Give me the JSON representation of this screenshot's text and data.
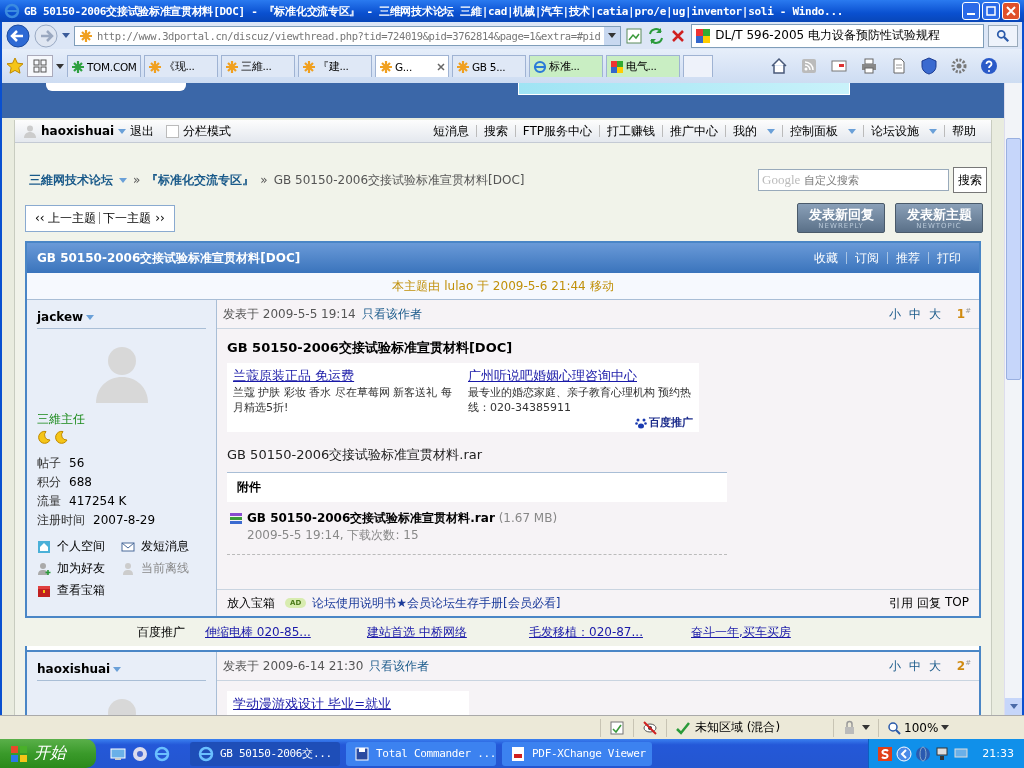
{
  "window": {
    "title": "GB 50150-2006交接试验标准宣贯材料[DOC] - 『标准化交流专区』 - 三维网技术论坛 三維|cad|机械|汽车|技术|catia|pro/e|ug|inventor|soli - Windo..."
  },
  "address_bar": {
    "url": "http://www.3dportal.cn/discuz/viewthread.php?tid=724019&pid=3762814&page=1&extra=#pid",
    "search_value": "DL/T 596-2005 电力设备预防性试验规程"
  },
  "tabs": [
    {
      "label": "TOM.COM",
      "kind": "tom",
      "selected": false
    },
    {
      "label": "《现...",
      "kind": "flower",
      "selected": false
    },
    {
      "label": "三維...",
      "kind": "flower",
      "selected": false
    },
    {
      "label": "『建...",
      "kind": "flower",
      "selected": false
    },
    {
      "label": "G...",
      "kind": "flower",
      "selected": true
    },
    {
      "label": "GB 5...",
      "kind": "flower",
      "selected": false
    },
    {
      "label": "标准...",
      "kind": "ie",
      "selected": false,
      "color": "#c9eec3"
    },
    {
      "label": "电气...",
      "kind": "google",
      "selected": false,
      "color": "#c9eec3"
    }
  ],
  "forum": {
    "user_bar": {
      "username": "haoxishuai",
      "logout": "退出",
      "split_mode": {
        "label": "分栏模式",
        "checked": false
      },
      "menu": [
        {
          "label": "短消息",
          "dropdown": false
        },
        {
          "label": "搜索",
          "dropdown": false
        },
        {
          "label": "FTP服务中心",
          "dropdown": false
        },
        {
          "label": "打工赚钱",
          "dropdown": false
        },
        {
          "label": "推广中心",
          "dropdown": false
        },
        {
          "label": "我的",
          "dropdown": true
        },
        {
          "label": "控制面板",
          "dropdown": true
        },
        {
          "label": "论坛设施",
          "dropdown": true
        },
        {
          "label": "帮助",
          "dropdown": false
        }
      ]
    },
    "breadcrumb": {
      "separator": "»",
      "items": [
        "三維网技术论坛",
        "『标准化交流专区』",
        "GB 50150-2006交接试验标准宣贯材料[DOC]"
      ]
    },
    "search": {
      "logo": "Google",
      "placeholder": "自定义搜索",
      "button": "搜索"
    },
    "thread_nav": [
      "‹‹ 上一主题",
      "下一主题 ››"
    ],
    "action_buttons": [
      {
        "label": "发表新回复",
        "sublabel": "NEWREPLY"
      },
      {
        "label": "发表新主题",
        "sublabel": "NEWTOPIC"
      }
    ],
    "thread": {
      "title": "GB 50150-2006交接试验标准宣贯材料[DOC]",
      "actions": [
        "收藏",
        "订阅",
        "推荐",
        "打印"
      ],
      "notice": "本主题由 lulao 于 2009-5-6 21:44 移动"
    },
    "posts": [
      {
        "author": "jackew",
        "rank": "三維主任",
        "rank_icons": [
          {
            "kind": "moon"
          },
          {
            "kind": "moon"
          }
        ],
        "stats": [
          {
            "label": "帖子",
            "value": "56"
          },
          {
            "label": "积分",
            "value": "688"
          },
          {
            "label": "流量",
            "value": "417254 K"
          },
          {
            "label": "注册时间",
            "value": "2007-8-29"
          }
        ],
        "links": [
          {
            "label": "个人空间",
            "kind": "home"
          },
          {
            "label": "发短消息",
            "kind": "mail"
          },
          {
            "label": "加为好友",
            "kind": "add"
          },
          {
            "label": "当前离线",
            "kind": "offline"
          },
          {
            "label": "查看宝箱",
            "kind": "box"
          }
        ],
        "posted": "发表于 2009-5-5 19:14",
        "only_author": "只看该作者",
        "font_sizes": [
          "小",
          "中",
          "大"
        ],
        "floor": "1$^{#}$",
        "title": "GB 50150-2006交接试验标准宣贯材料[DOC]",
        "ads": [
          {
            "title": "兰蔻原装正品 免运费",
            "desc": "兰蔻 护肤 彩妆 香水 尽在草莓网 新客送礼 每月精选5折!"
          },
          {
            "title": "广州听说吧婚姻心理咨询中心",
            "desc": "最专业的婚恋家庭、亲子教育心理机构 预约热线：020-34385911"
          }
        ],
        "ads_brand": "百度推广",
        "body": "GB 50150-2006交接试验标准宣贯材料.rar",
        "attachment": {
          "heading": "附件",
          "name": "GB 50150-2006交接试验标准宣贯材料.rar",
          "size": "(1.67 MB)",
          "meta": "2009-5-5 19:14, 下载次数: 15"
        },
        "footer": {
          "left": "放入宝箱",
          "badge": "AD",
          "link": "论坛使用说明书★会员论坛生存手册[会员必看]",
          "actions": [
            "引用",
            "回复",
            "TOP"
          ]
        }
      },
      {
        "author": "haoxishuai",
        "posted": "发表于 2009-6-14 21:30",
        "only_author": "只看该作者",
        "font_sizes": [
          "小",
          "中",
          "大"
        ],
        "floor": "2$^{#}$",
        "ads": [
          {
            "title": "学动漫游戏设计 毕业=就业"
          }
        ]
      }
    ],
    "baidu_row": {
      "label": "百度推广",
      "links": [
        "伸缩电棒 020-85...",
        "建站首选 中桥网络",
        "毛发移植：020-87...",
        "奋斗一年,买车买房"
      ]
    }
  },
  "status_bar": {
    "zone": "未知区域 (混合)",
    "zoom": "100%"
  },
  "taskbar": {
    "start": "开始",
    "tasks": [
      {
        "label": "GB 50150-2006交...",
        "kind": "ie",
        "selected": true
      },
      {
        "label": "Total Commander ...",
        "kind": "disk",
        "selected": false
      },
      {
        "label": "PDF-XChange Viewer",
        "kind": "pdf",
        "selected": false
      }
    ],
    "clock": "21:33"
  }
}
